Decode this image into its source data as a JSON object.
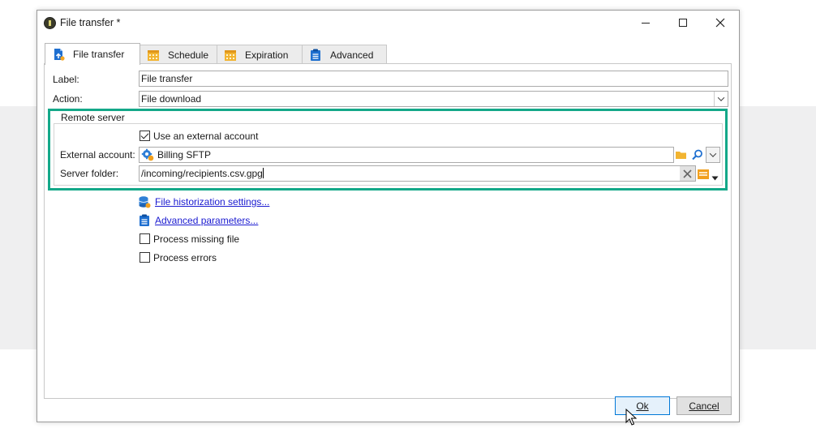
{
  "window": {
    "title": "File transfer *"
  },
  "tabs": [
    {
      "label": "File transfer",
      "icon": "file-transfer-icon",
      "active": true
    },
    {
      "label": "Schedule",
      "icon": "calendar-icon",
      "active": false
    },
    {
      "label": "Expiration",
      "icon": "calendar-icon",
      "active": false
    },
    {
      "label": "Advanced",
      "icon": "clipboard-icon",
      "active": false
    }
  ],
  "form": {
    "label_caption": "Label:",
    "label_value": "File transfer",
    "action_caption": "Action:",
    "action_value": "File download"
  },
  "remote_server": {
    "legend": "Remote server",
    "use_external_label": "Use an external account",
    "use_external_checked": true,
    "external_account_caption": "External account:",
    "external_account_value": "Billing SFTP",
    "server_folder_caption": "Server folder:",
    "server_folder_value": "/incoming/recipients.csv.gpg"
  },
  "links": {
    "historization": "File historization settings...",
    "advanced_params": "Advanced parameters..."
  },
  "options": {
    "process_missing_label": "Process missing file",
    "process_missing_checked": false,
    "process_errors_label": "Process errors",
    "process_errors_checked": false
  },
  "buttons": {
    "ok_label": "Ok",
    "cancel_label": "Cancel"
  },
  "colors": {
    "highlight": "#14a889",
    "link": "#1a1ad0",
    "calendar": "#f2b431",
    "accent_blue": "#1e6fd0"
  }
}
